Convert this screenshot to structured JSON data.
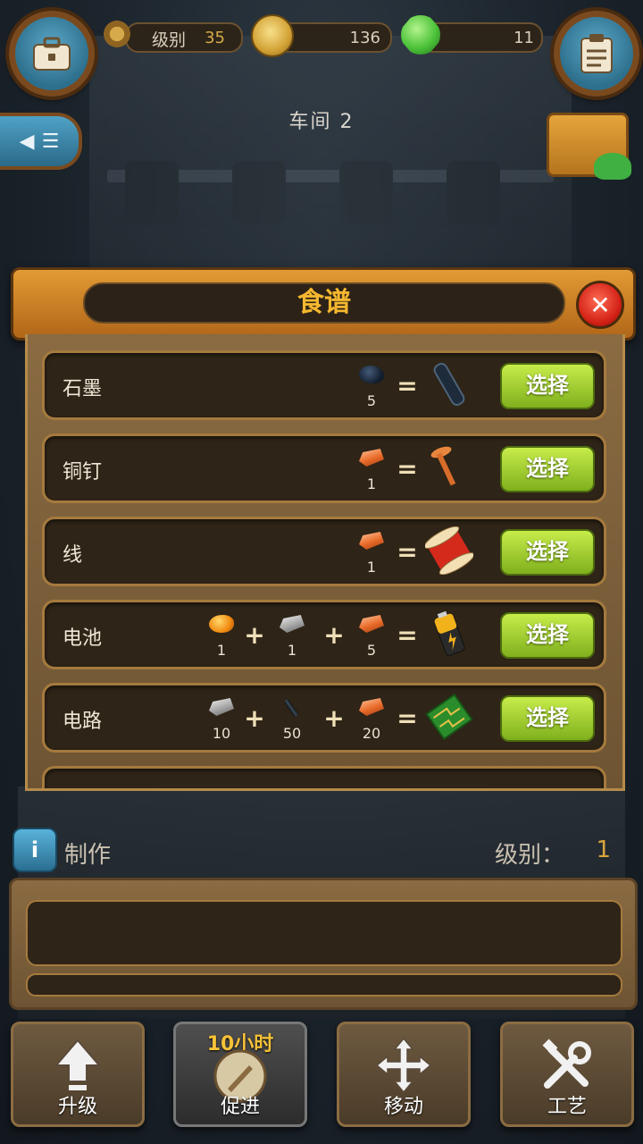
{
  "topbar": {
    "level_label": "级别",
    "level_value": "35",
    "coins": "136",
    "gems": "11"
  },
  "workshop_title": "车间 2",
  "side_page": "2",
  "dialog": {
    "title": "食谱",
    "select_label": "选择",
    "recipes": [
      {
        "name": "石墨",
        "ingredients": [
          {
            "icon": "coal-icon",
            "qty": "5"
          }
        ],
        "product_icon": "graphite-rod-icon"
      },
      {
        "name": "铜钉",
        "ingredients": [
          {
            "icon": "copper-ingot-icon",
            "qty": "1"
          }
        ],
        "product_icon": "copper-nail-icon"
      },
      {
        "name": "线",
        "ingredients": [
          {
            "icon": "copper-ingot-icon",
            "qty": "1"
          }
        ],
        "product_icon": "wire-spool-icon"
      },
      {
        "name": "电池",
        "ingredients": [
          {
            "icon": "gold-nugget-icon",
            "qty": "1"
          },
          {
            "icon": "silver-ingot-icon",
            "qty": "1"
          },
          {
            "icon": "copper-ingot-icon",
            "qty": "5"
          }
        ],
        "product_icon": "battery-icon"
      },
      {
        "name": "电路",
        "ingredients": [
          {
            "icon": "silver-ingot-icon",
            "qty": "10"
          },
          {
            "icon": "graphite-icon",
            "qty": "50"
          },
          {
            "icon": "copper-ingot-icon",
            "qty": "20"
          }
        ],
        "product_icon": "circuit-board-icon"
      }
    ]
  },
  "craft": {
    "label": "制作",
    "level_label": "级别：",
    "level_value": "1"
  },
  "bottom": {
    "upgrade": "升级",
    "boost": "促进",
    "boost_timer": "10小时",
    "move": "移动",
    "craft": "工艺"
  },
  "colors": {
    "accent_orange": "#e29a34",
    "select_green": "#a8d437",
    "title_gold": "#f4b72f"
  }
}
